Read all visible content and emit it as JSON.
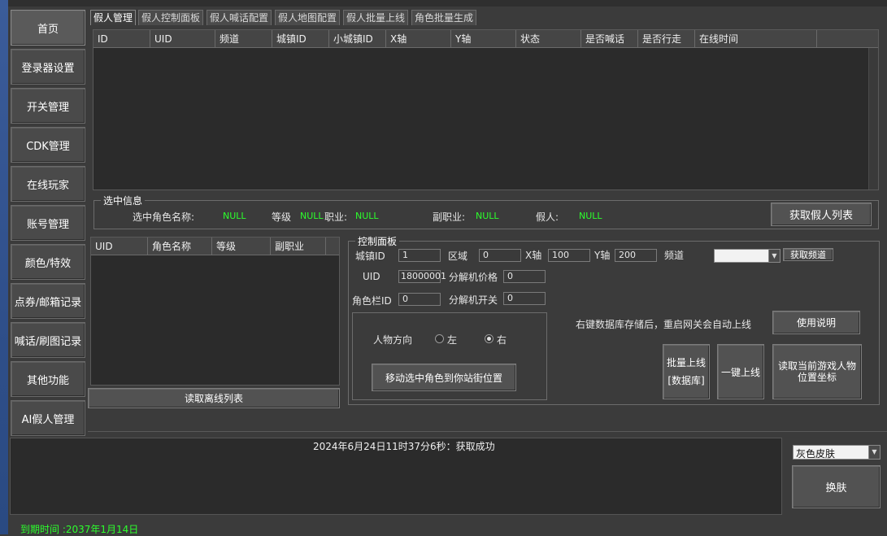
{
  "sidebar": {
    "items": [
      "首页",
      "登录器设置",
      "开关管理",
      "CDK管理",
      "在线玩家",
      "账号管理",
      "颜色/特效",
      "点券/邮箱记录",
      "喊话/刷图记录",
      "其他功能",
      "AI假人管理"
    ]
  },
  "tabs": [
    "假人管理",
    "假人控制面板",
    "假人喊话配置",
    "假人地图配置",
    "假人批量上线",
    "角色批量生成"
  ],
  "main_grid": {
    "columns": [
      "ID",
      "UID",
      "频道",
      "城镇ID",
      "小城镇ID",
      "X轴",
      "Y轴",
      "状态",
      "是否喊话",
      "是否行走",
      "在线时间"
    ]
  },
  "selected_info": {
    "title": "选中信息",
    "name_label": "选中角色名称:",
    "name_value": "NULL",
    "level_label": "等级",
    "level_value": "NULL",
    "job_label": "职业:",
    "job_value": "NULL",
    "subjob_label": "副职业:",
    "subjob_value": "NULL",
    "fake_label": "假人:",
    "fake_value": "NULL",
    "get_list_button": "获取假人列表"
  },
  "offline_grid": {
    "columns": [
      "UID",
      "角色名称",
      "等级",
      "副职业"
    ],
    "read_button": "读取离线列表"
  },
  "control_panel": {
    "title": "控制面板",
    "town_id_label": "城镇ID",
    "town_id_value": "1",
    "area_label": "区域",
    "area_value": "0",
    "x_label": "X轴",
    "x_value": "100",
    "y_label": "Y轴",
    "y_value": "200",
    "channel_label": "频道",
    "channel_value": "",
    "get_channel_button": "获取频道",
    "uid_label": "UID",
    "uid_value": "18000001",
    "decompose_price_label": "分解机价格",
    "decompose_price_value": "0",
    "slot_id_label": "角色栏ID",
    "slot_id_value": "0",
    "decompose_switch_label": "分解机开关",
    "decompose_switch_value": "0",
    "direction_label": "人物方向",
    "left_label": "左",
    "right_label": "右",
    "move_button": "移动选中角色到你站街位置",
    "hint": "右键数据库存储后，重启网关会自动上线",
    "usage_button": "使用说明",
    "batch_online_line1": "批量上线",
    "batch_online_line2": "[数据库]",
    "one_click_button": "一键上线",
    "read_coord_button": "读取当前游戏人物位置坐标"
  },
  "log": {
    "message": "2024年6月24日11时37分6秒：获取成功"
  },
  "skin": {
    "selected": "灰色皮肤",
    "change_button": "换肤"
  },
  "status": {
    "expiry": "到期时间 :2037年1月14日"
  },
  "colors": {
    "green_text": "#2cff2c",
    "background": "#3b3b3b",
    "panel_dark": "#2b2b2b"
  }
}
